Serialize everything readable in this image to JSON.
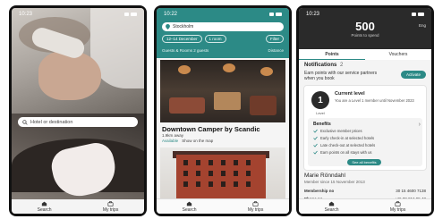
{
  "phone1": {
    "time": "10:23",
    "search_placeholder": "Hotel or destination",
    "tabs": [
      "Search",
      "My trips"
    ]
  },
  "phone2": {
    "time": "10:22",
    "search_value": "Stockholm",
    "chips": [
      "12–14 December",
      "1 room",
      "Filter"
    ],
    "sort_label": "Guests & Rooms 2 guests",
    "distance_label": "Distance",
    "hotel_name": "Downtown Camper by Scandic",
    "hotel_distance": "1.9km away",
    "hotel_tags": [
      "Available",
      "Show on the map"
    ],
    "tabs": [
      "Search",
      "My trips"
    ]
  },
  "phone3": {
    "time": "10:23",
    "points": "500",
    "points_label": "Points to spend",
    "language": "Eng",
    "tabs": [
      "Points",
      "Vouchers"
    ],
    "notifications_title": "Notifications",
    "notifications_count": "2",
    "notification_text": "Earn points with our service partners when you book",
    "activate_label": "Activate",
    "level_number": "1",
    "level_label": "Level",
    "level_title": "Current level",
    "level_desc": "You are a Level 1 member until November 2023",
    "benefits_title": "Benefits",
    "benefits": [
      "Exclusive member prices",
      "Early check-in at selected hotels",
      "Late check-out at selected hotels",
      "Earn points on all stays with us"
    ],
    "see_all_label": "See all benefits",
    "member_name": "Marie Rönndahl",
    "member_since": "Member since 15 November 2013",
    "rows": [
      {
        "label": "Membership no",
        "value": "30 15 4600 7138"
      },
      {
        "label": "Phone no",
        "value": "+46 72 654 95 48"
      }
    ],
    "bottom_tabs": [
      "Search",
      "My trips"
    ]
  }
}
